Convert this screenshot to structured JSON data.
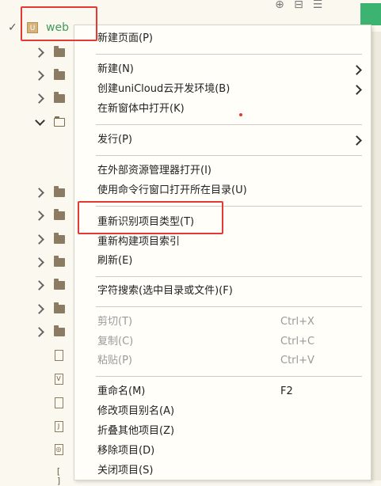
{
  "tree": {
    "project_name": "web",
    "project_icon_glyph": "U"
  },
  "context_menu": {
    "items": [
      {
        "label": "新建页面(P)"
      },
      {
        "label": "新建(N)"
      },
      {
        "label": "创建uniCloud云开发环境(B)"
      },
      {
        "label": "在新窗体中打开(K)"
      },
      {
        "label": "发行(P)"
      },
      {
        "label": "在外部资源管理器打开(I)"
      },
      {
        "label": "使用命令行窗口打开所在目录(U)"
      },
      {
        "label": "重新识别项目类型(T)"
      },
      {
        "label": "重新构建项目索引"
      },
      {
        "label": "刷新(E)"
      },
      {
        "label": "字符搜索(选中目录或文件)(F)"
      },
      {
        "label": "剪切(T)",
        "shortcut": "Ctrl+X",
        "disabled": true
      },
      {
        "label": "复制(C)",
        "shortcut": "Ctrl+C",
        "disabled": true
      },
      {
        "label": "粘贴(P)",
        "shortcut": "Ctrl+V",
        "disabled": true
      },
      {
        "label": "重命名(M)",
        "shortcut": "F2"
      },
      {
        "label": "修改项目别名(A)"
      },
      {
        "label": "折叠其他项目(Z)"
      },
      {
        "label": "移除项目(D)"
      },
      {
        "label": "关闭项目(S)"
      }
    ]
  },
  "colors": {
    "highlight_box": "#e53935",
    "project_name": "#3e9b5b",
    "accent_tab": "#3cb371"
  },
  "file_icon_glyphs": [
    "",
    "V",
    "",
    "J",
    "◎",
    "[ ]"
  ]
}
